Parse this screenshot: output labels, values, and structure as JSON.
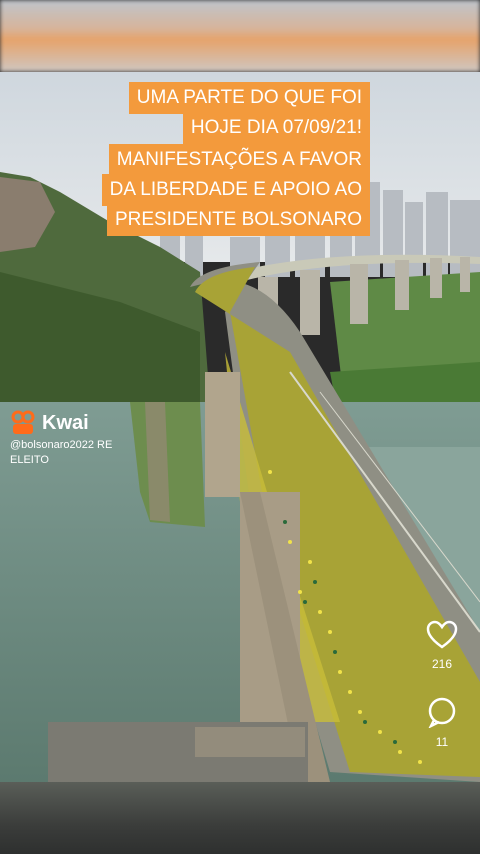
{
  "caption": {
    "lines": [
      "UMA PARTE DO QUE FOI",
      "HOJE DIA 07/09/21!",
      "MANIFESTAÇÕES A FAVOR",
      "DA LIBERDADE E APOIO AO",
      "PRESIDENTE BOLSONARO"
    ],
    "bg_color": "#f39a3c"
  },
  "watermark": {
    "brand": "Kwai",
    "username": "@bolsonaro2022 RE ELEITO",
    "icon": "kwai-logo-icon"
  },
  "actions": {
    "like_count": "216",
    "comment_count": "11",
    "like_icon": "heart-icon",
    "comment_icon": "comment-bubble-icon"
  }
}
